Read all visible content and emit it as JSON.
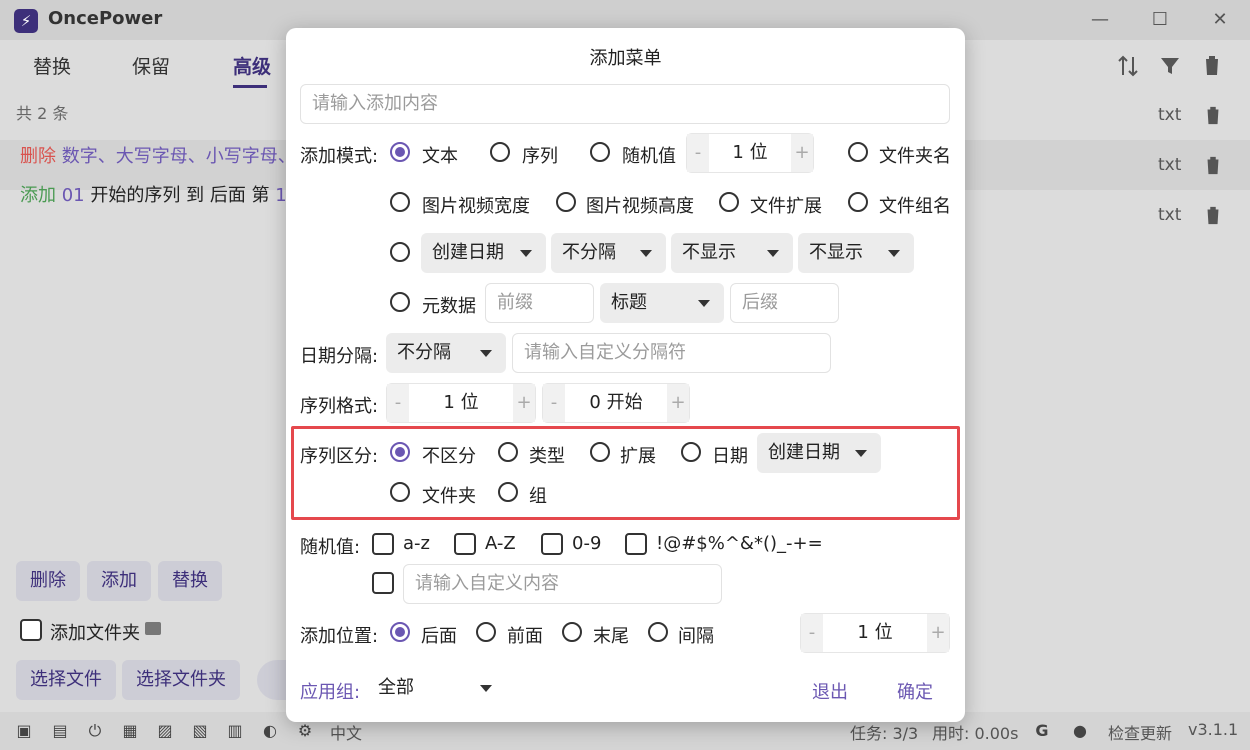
{
  "app": {
    "title": "OncePower",
    "window_controls": {
      "minimize": "—",
      "maximize": "☐",
      "close": "✕"
    },
    "tabs": [
      {
        "label": "替换"
      },
      {
        "label": "保留"
      },
      {
        "label": "高级"
      }
    ],
    "count_label": "共 2 条",
    "rules": [
      {
        "action": "删除",
        "text": "数字、大写字母、小写字母、",
        "action_color": "#d9534f",
        "text_color": "#6b57b2"
      },
      {
        "action": "添加",
        "num": "01",
        "text": "开始的序列 到 后面 第",
        "num2": "1",
        "action_color": "#4a9a52",
        "text_color": "#6b57b2"
      }
    ],
    "file_ext_labels": [
      "txt",
      "txt",
      "txt"
    ],
    "buttons": {
      "delete": "删除",
      "add": "添加",
      "replace": "替换",
      "select_file": "选择文件",
      "select_folder": "选择文件夹"
    },
    "add_folder_label": "添加文件夹",
    "status": {
      "language": "中文",
      "tasks": "任务: 3/3",
      "time": "用时: 0.00s",
      "check_update": "检查更新",
      "version": "v3.1.1"
    }
  },
  "dialog": {
    "title": "添加菜单",
    "content_input": {
      "placeholder": "请输入添加内容",
      "value": ""
    },
    "add_mode": {
      "label": "添加模式:",
      "options": [
        "文本",
        "序列",
        "随机值",
        "文件夹名",
        "图片视频宽度",
        "图片视频高度",
        "文件扩展",
        "文件组名",
        "元数据"
      ],
      "selected": "文本",
      "random_digits": {
        "minus": "-",
        "value": "1 位",
        "plus": "+"
      },
      "date_selects": [
        "创建日期",
        "不分隔",
        "不显示",
        "不显示"
      ],
      "meta": {
        "prefix_placeholder": "前缀",
        "field": "标题",
        "suffix_placeholder": "后缀"
      }
    },
    "date_sep": {
      "label": "日期分隔:",
      "value": "不分隔",
      "custom_placeholder": "请输入自定义分隔符"
    },
    "seq_format": {
      "label": "序列格式:",
      "digits": "1 位",
      "start": "0 开始",
      "minus": "-",
      "plus": "+"
    },
    "seq_split": {
      "label": "序列区分:",
      "options": [
        "不区分",
        "类型",
        "扩展",
        "日期",
        "文件夹",
        "组"
      ],
      "selected": "不区分",
      "date_select": "创建日期",
      "highlight_color": "#e5484d"
    },
    "random": {
      "label": "随机值:",
      "options": [
        "a-z",
        "A-Z",
        "0-9",
        "!@#$%^&*()_-+="
      ],
      "custom_placeholder": "请输入自定义内容"
    },
    "position": {
      "label": "添加位置:",
      "options": [
        "后面",
        "前面",
        "末尾",
        "间隔"
      ],
      "selected": "后面",
      "interval": "1 位",
      "minus": "-",
      "plus": "+"
    },
    "apply_group": {
      "label": "应用组:",
      "value": "全部"
    },
    "exit_label": "退出",
    "confirm_label": "确定",
    "accent_color": "#6b57b2"
  }
}
